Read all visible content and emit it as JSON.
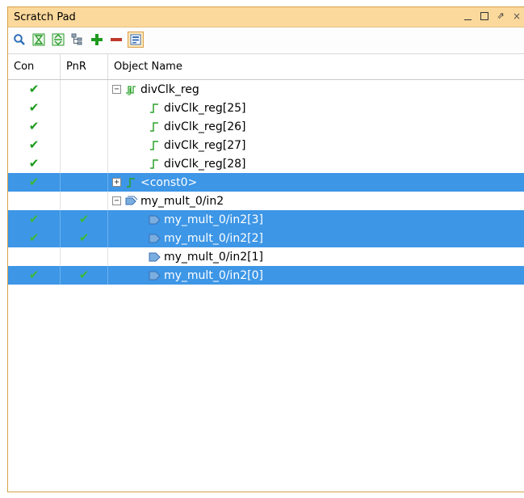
{
  "window": {
    "title": "Scratch Pad",
    "controls": [
      "minimize",
      "maximize",
      "float",
      "close"
    ]
  },
  "toolbar": {
    "icons": [
      "search-icon",
      "collapse-all-icon",
      "expand-icon",
      "hierarchy-icon",
      "add-icon",
      "remove-icon",
      "toggle-view-icon"
    ]
  },
  "table": {
    "columns": [
      "Con",
      "PnR",
      "Object Name"
    ],
    "rows": [
      {
        "con": "✔",
        "pnr": "",
        "name": "divClk_reg",
        "depth": 0,
        "expander": "−",
        "icon": "bus-icon",
        "selected": false
      },
      {
        "con": "✔",
        "pnr": "",
        "name": "divClk_reg[25]",
        "depth": 1,
        "expander": "",
        "icon": "net-icon",
        "selected": false
      },
      {
        "con": "✔",
        "pnr": "",
        "name": "divClk_reg[26]",
        "depth": 1,
        "expander": "",
        "icon": "net-icon",
        "selected": false
      },
      {
        "con": "✔",
        "pnr": "",
        "name": "divClk_reg[27]",
        "depth": 1,
        "expander": "",
        "icon": "net-icon",
        "selected": false
      },
      {
        "con": "✔",
        "pnr": "",
        "name": "divClk_reg[28]",
        "depth": 1,
        "expander": "",
        "icon": "net-icon",
        "selected": false
      },
      {
        "con": "✔",
        "pnr": "",
        "name": "<const0>",
        "depth": 0,
        "expander": "+",
        "icon": "net-icon",
        "selected": true
      },
      {
        "con": "",
        "pnr": "",
        "name": "my_mult_0/in2",
        "depth": 0,
        "expander": "−",
        "icon": "port-bus-icon",
        "selected": false
      },
      {
        "con": "✔",
        "pnr": "✔",
        "name": "my_mult_0/in2[3]",
        "depth": 1,
        "expander": "",
        "icon": "port-icon",
        "selected": true
      },
      {
        "con": "✔",
        "pnr": "✔",
        "name": "my_mult_0/in2[2]",
        "depth": 1,
        "expander": "",
        "icon": "port-icon",
        "selected": true
      },
      {
        "con": "",
        "pnr": "",
        "name": "my_mult_0/in2[1]",
        "depth": 1,
        "expander": "",
        "icon": "port-icon",
        "selected": false
      },
      {
        "con": "✔",
        "pnr": "✔",
        "name": "my_mult_0/in2[0]",
        "depth": 1,
        "expander": "",
        "icon": "port-icon",
        "selected": true
      }
    ]
  },
  "colors": {
    "title_bg": "#fbd99c",
    "selection": "#3d96e6",
    "check": "#1b9a1b"
  }
}
